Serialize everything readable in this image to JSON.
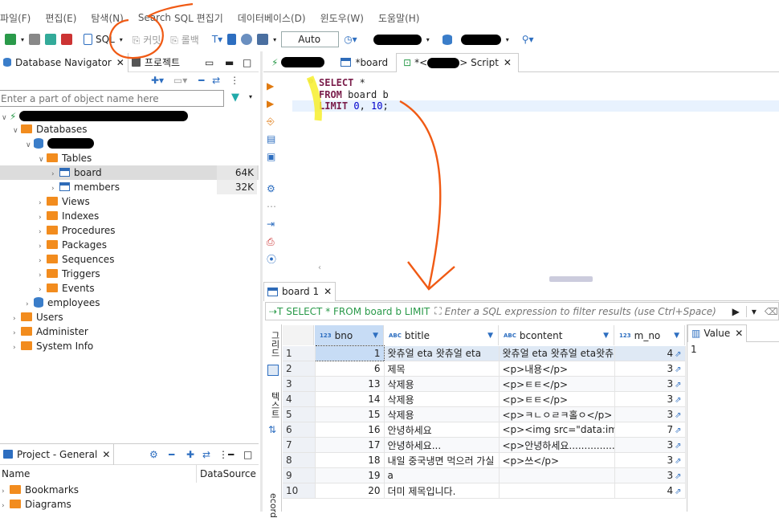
{
  "menu": [
    "파일(F)",
    "편집(E)",
    "탐색(N)",
    "Search",
    "SQL 편집기",
    "데이터베이스(D)",
    "윈도우(W)",
    "도움말(H)"
  ],
  "toolbar": {
    "sql_label": "SQL",
    "commit_label": "커밋",
    "rollback_label": "롤백",
    "tx_mode": "Auto"
  },
  "nav": {
    "tab1": "Database Navigator",
    "tab2": "프로젝트",
    "filter_placeholder": "Enter a part of object name here"
  },
  "tree": {
    "databases": "Databases",
    "tables": "Tables",
    "rows": [
      {
        "name": "board",
        "size": "64K"
      },
      {
        "name": "members",
        "size": "32K"
      }
    ],
    "sub": [
      "Views",
      "Indexes",
      "Procedures",
      "Packages",
      "Sequences",
      "Triggers",
      "Events"
    ],
    "employees": "employees",
    "users": "Users",
    "administer": "Administer",
    "sysinfo": "System Info"
  },
  "project": {
    "tab": "Project - General",
    "col_name": "Name",
    "col_ds": "DataSource",
    "items": [
      "Bookmarks",
      "Diagrams"
    ]
  },
  "editor_tabs": {
    "board": "*board",
    "script_prefix": "*<",
    "script_suffix": "> Script"
  },
  "sql": {
    "l1_kw": "SELECT",
    "l1_rest": " *",
    "l2_kw": "FROM",
    "l2_rest": "  board b",
    "l3_kw": "LIMIT",
    "l3_n1": "0",
    "l3_sep": ", ",
    "l3_n2": "10",
    "l3_end": ";"
  },
  "results": {
    "tab": "board 1",
    "query": "SELECT * FROM board b LIMIT",
    "filter_placeholder": "Enter a SQL expression to filter results (use Ctrl+Space)",
    "side1": "그리드",
    "side2": "텍스트",
    "side3": "ecord",
    "columns": [
      "bno",
      "btitle",
      "bcontent",
      "m_no"
    ],
    "type_num": "123",
    "type_abc": "ABC",
    "rows": [
      {
        "n": "1",
        "bno": "1",
        "btitle": "왓츄얼 eta 왓츄얼 eta",
        "bcontent": "왓츄얼 eta 왓츄얼 eta왓츄",
        "m_no": "4"
      },
      {
        "n": "2",
        "bno": "6",
        "btitle": "제목",
        "bcontent": "<p>내용</p>",
        "m_no": "3"
      },
      {
        "n": "3",
        "bno": "13",
        "btitle": "삭제용",
        "bcontent": "<p>ㅌㅌ</p>",
        "m_no": "3"
      },
      {
        "n": "4",
        "bno": "14",
        "btitle": "삭제용",
        "bcontent": "<p>ㅌㅌ</p>",
        "m_no": "3"
      },
      {
        "n": "5",
        "bno": "15",
        "btitle": "삭제용",
        "bcontent": "<p>ㅋㄴㅇㄹㅋ홀ㅇ</p>",
        "m_no": "3"
      },
      {
        "n": "6",
        "bno": "16",
        "btitle": "안녕하세요",
        "bcontent": "<p><img src=\"data:image",
        "m_no": "7"
      },
      {
        "n": "7",
        "bno": "17",
        "btitle": "안녕하세요...",
        "bcontent": "<p>안녕하세요..................",
        "m_no": "3"
      },
      {
        "n": "8",
        "bno": "18",
        "btitle": "내일 중국냉면 먹으러 가실",
        "bcontent": "<p>쓰</p>",
        "m_no": "3"
      },
      {
        "n": "9",
        "bno": "19",
        "btitle": "a",
        "bcontent": "",
        "m_no": "3"
      },
      {
        "n": "10",
        "bno": "20",
        "btitle": "더미 제목입니다.",
        "bcontent": "",
        "m_no": "4"
      }
    ],
    "value_tab": "Value",
    "value": "1"
  }
}
